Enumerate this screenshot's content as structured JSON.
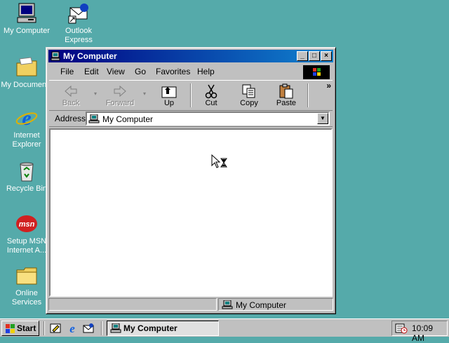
{
  "colors": {
    "desktop": "#55aaaa",
    "title_active": "#000080",
    "face": "#c0c0c0"
  },
  "desktop_icons": [
    {
      "label": "My Computer",
      "icon": "my-computer-icon"
    },
    {
      "label": "Outlook Express",
      "icon": "outlook-express-icon"
    },
    {
      "label": "My Documents",
      "icon": "folder-icon"
    },
    {
      "label": "Internet Explorer",
      "icon": "internet-explorer-icon"
    },
    {
      "label": "Recycle Bin",
      "icon": "recycle-bin-icon"
    },
    {
      "label": "Setup MSN Internet A...",
      "icon": "msn-icon"
    },
    {
      "label": "Online Services",
      "icon": "folder-icon"
    }
  ],
  "window": {
    "title": "My Computer",
    "controls": {
      "minimize": "_",
      "maximize": "□",
      "close": "×"
    },
    "menu": [
      "File",
      "Edit",
      "View",
      "Go",
      "Favorites",
      "Help"
    ],
    "toolbar": {
      "back": "Back",
      "forward": "Forward",
      "up": "Up",
      "cut": "Cut",
      "copy": "Copy",
      "paste": "Paste",
      "more": "»"
    },
    "address": {
      "label": "Address",
      "value": "My Computer"
    },
    "status": {
      "text": "My Computer"
    }
  },
  "taskbar": {
    "start": "Start",
    "task_button": "My Computer",
    "clock": "10:09 AM"
  }
}
